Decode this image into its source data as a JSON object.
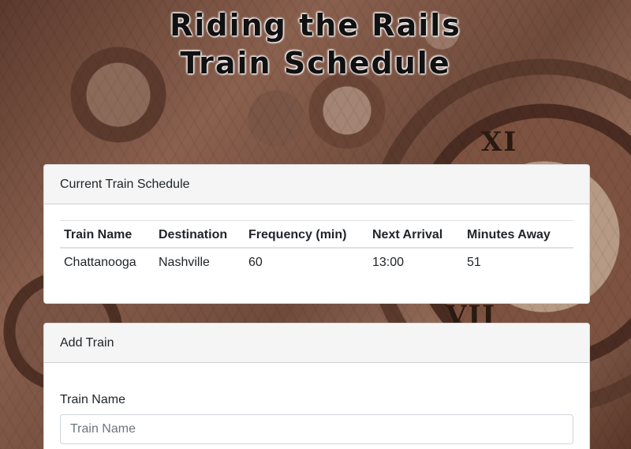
{
  "page": {
    "title": "Riding the Rails Train Schedule"
  },
  "schedule": {
    "header": "Current Train Schedule",
    "columns": [
      "Train Name",
      "Destination",
      "Frequency (min)",
      "Next Arrival",
      "Minutes Away"
    ],
    "rows": [
      [
        "Chattanooga",
        "Nashville",
        "60",
        "13:00",
        "51"
      ]
    ]
  },
  "add_train": {
    "header": "Add Train",
    "train_name_label": "Train Name",
    "train_name_placeholder": "Train Name",
    "train_name_value": ""
  }
}
